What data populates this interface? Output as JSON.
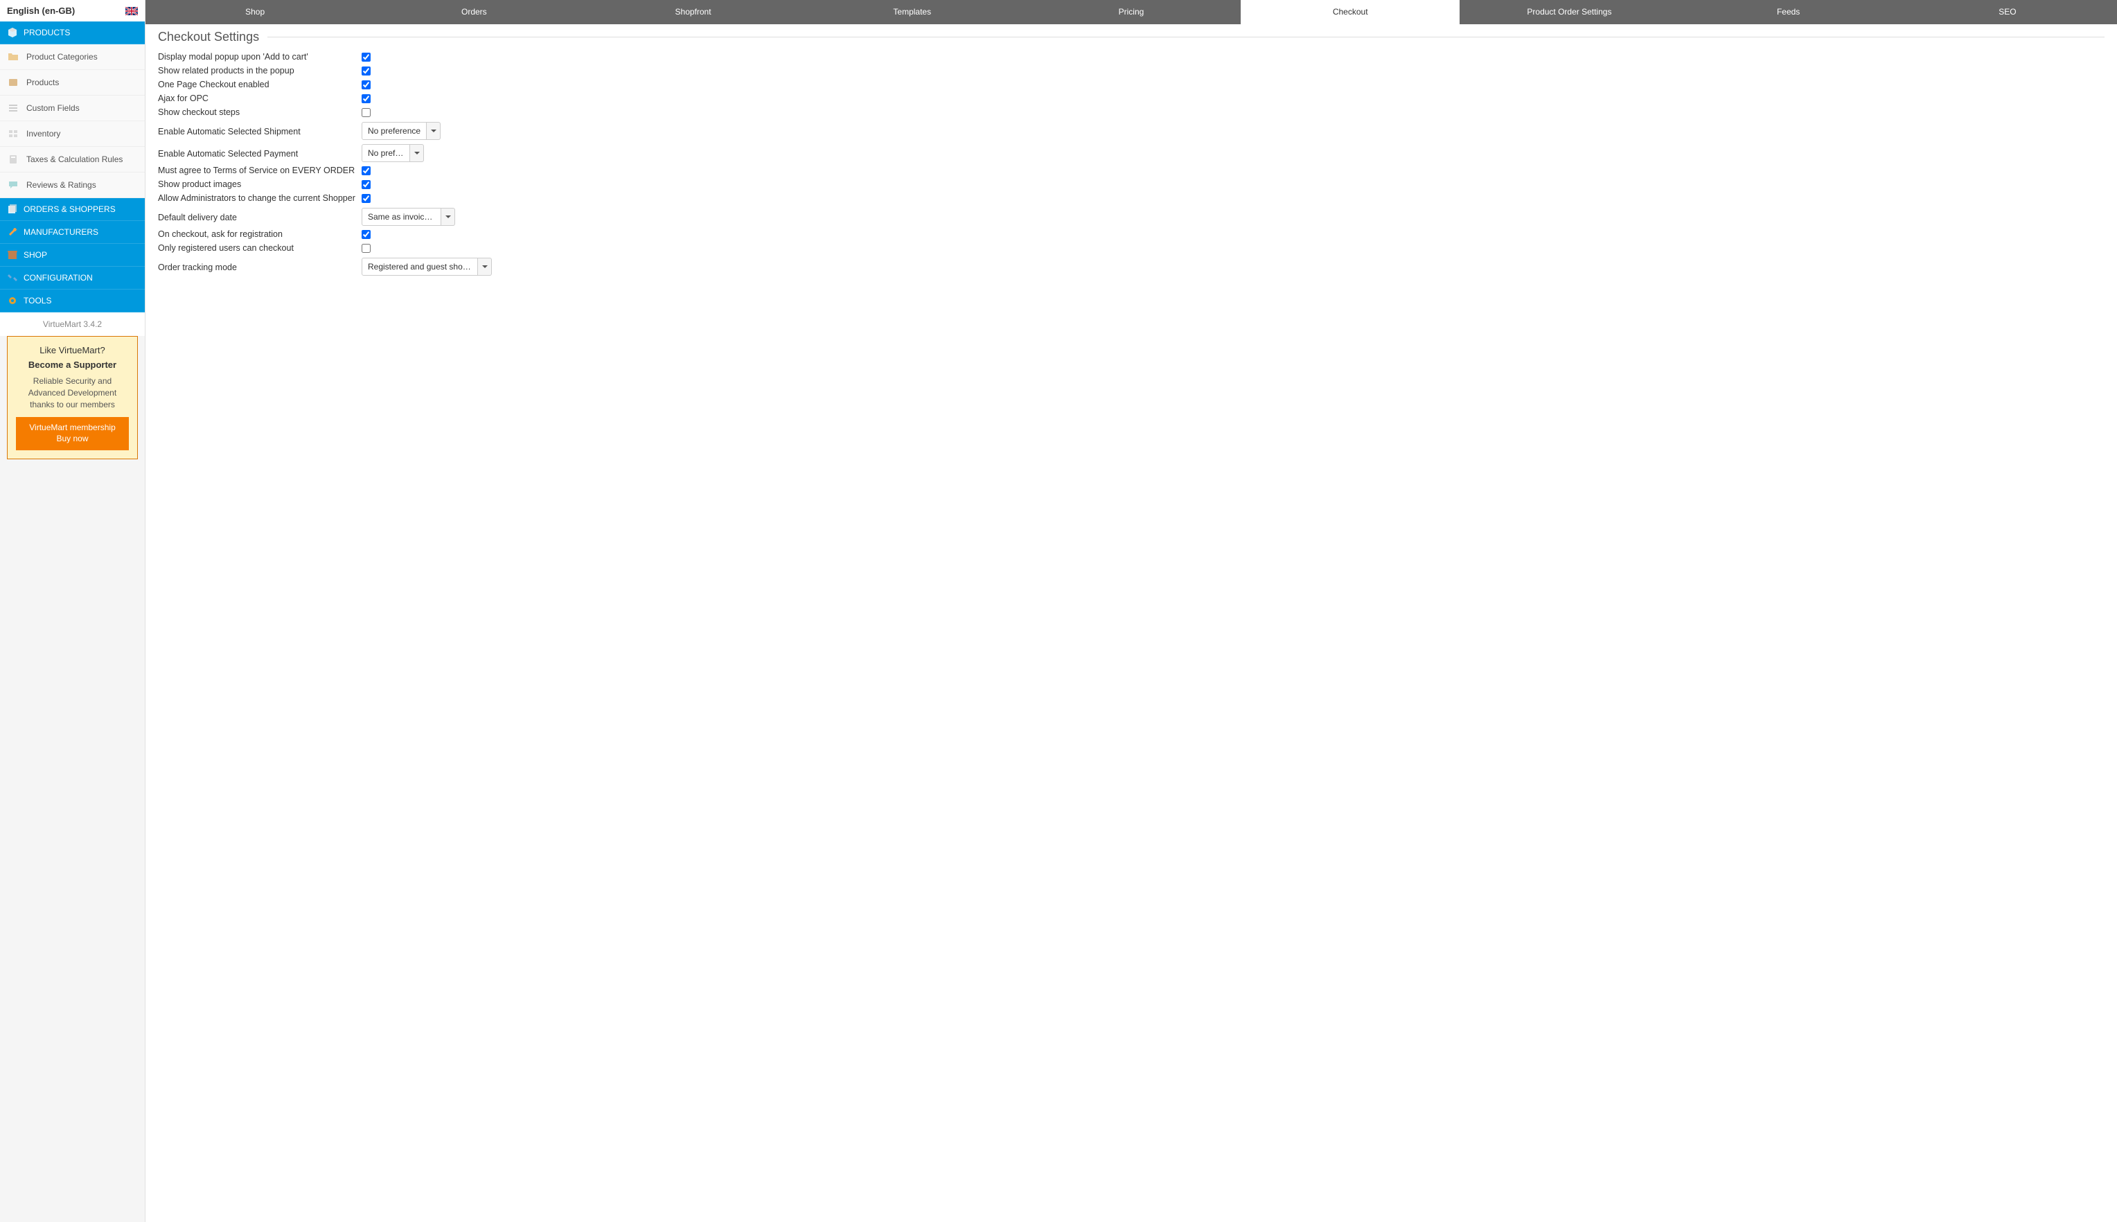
{
  "lang": "English (en-GB)",
  "sidebar": {
    "products_header": "PRODUCTS",
    "submenu": [
      "Product Categories",
      "Products",
      "Custom Fields",
      "Inventory",
      "Taxes & Calculation Rules",
      "Reviews & Ratings"
    ],
    "sections": [
      "ORDERS & SHOPPERS",
      "MANUFACTURERS",
      "SHOP",
      "CONFIGURATION",
      "TOOLS"
    ]
  },
  "version": "VirtueMart 3.4.2",
  "promo": {
    "line1": "Like VirtueMart?",
    "line2": "Become a Supporter",
    "line3": "Reliable Security and Advanced Development thanks to our members",
    "button": "VirtueMart membership Buy now"
  },
  "tabs": [
    "Shop",
    "Orders",
    "Shopfront",
    "Templates",
    "Pricing",
    "Checkout",
    "Product Order Settings",
    "Feeds",
    "SEO"
  ],
  "active_tab": 5,
  "page_title": "Checkout Settings",
  "settings": {
    "r0": {
      "label": "Display modal popup upon 'Add to cart'",
      "checked": true
    },
    "r1": {
      "label": "Show related products in the popup",
      "checked": true
    },
    "r2": {
      "label": "One Page Checkout enabled",
      "checked": true
    },
    "r3": {
      "label": "Ajax for OPC",
      "checked": true
    },
    "r4": {
      "label": "Show checkout steps",
      "checked": false
    },
    "r5": {
      "label": "Enable Automatic Selected Shipment",
      "value": "No preference"
    },
    "r6": {
      "label": "Enable Automatic Selected Payment",
      "value": "No prefer…"
    },
    "r7": {
      "label": "Must agree to Terms of Service on EVERY ORDER",
      "checked": true
    },
    "r8": {
      "label": "Show product images",
      "checked": true
    },
    "r9": {
      "label": "Allow Administrators to change the current Shopper",
      "checked": true
    },
    "r10": {
      "label": "Default delivery date",
      "value": "Same as invoice …"
    },
    "r11": {
      "label": "On checkout, ask for registration",
      "checked": true
    },
    "r12": {
      "label": "Only registered users can checkout",
      "checked": false
    },
    "r13": {
      "label": "Order tracking mode",
      "value": "Registered and guest shop…"
    }
  }
}
